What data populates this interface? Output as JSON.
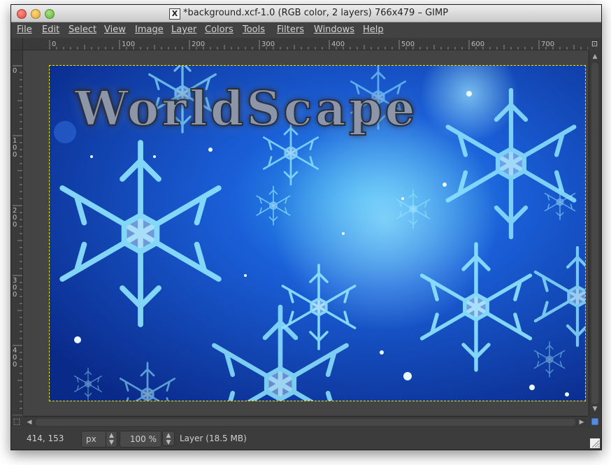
{
  "window": {
    "title": "*background.xcf-1.0 (RGB color, 2 layers) 766x479 – GIMP",
    "title_icon": "X"
  },
  "menu": [
    {
      "label": "File"
    },
    {
      "label": "Edit"
    },
    {
      "label": "Select"
    },
    {
      "label": "View"
    },
    {
      "label": "Image"
    },
    {
      "label": "Layer"
    },
    {
      "label": "Colors"
    },
    {
      "label": "Tools"
    },
    {
      "label": "Filters"
    },
    {
      "label": "Windows"
    },
    {
      "label": "Help"
    }
  ],
  "rulers": {
    "horizontal": [
      "0",
      "100",
      "200",
      "300",
      "400",
      "500",
      "600",
      "700"
    ],
    "vertical": [
      "0",
      "100",
      "200",
      "300",
      "400"
    ]
  },
  "image": {
    "text": "WorldScape",
    "colors": {
      "deep": "#0a2a8a",
      "mid": "#1a5fd8",
      "glow": "#35a8f0",
      "ice": "#8fe6ff"
    }
  },
  "status": {
    "coords": "414, 153",
    "unit": "px",
    "zoom": "100 %",
    "layer": "Layer (18.5 MB)"
  },
  "icons": {
    "zoom_toggle": "zoom-fit-icon",
    "quick_mask": "quick-mask-icon",
    "navigate": "navigate-icon",
    "resize": "resize-grip-icon"
  }
}
